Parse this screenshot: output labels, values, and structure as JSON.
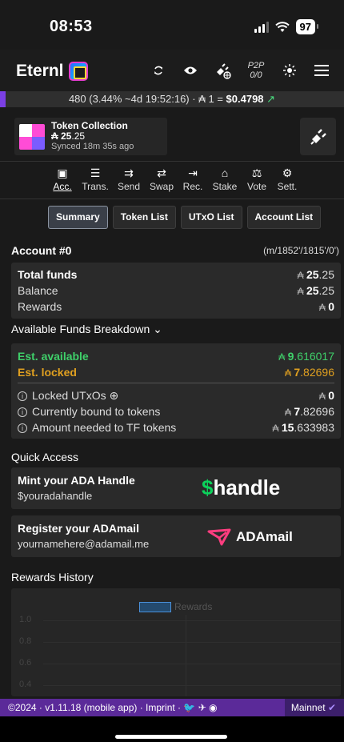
{
  "status_bar": {
    "time": "08:53",
    "battery": "97"
  },
  "header": {
    "brand": "Eternl",
    "p2p_top": "P2P",
    "p2p_bottom": "0/0",
    "icons": [
      "sync-icon",
      "eye-icon",
      "plug-globe-icon",
      "plug-p2p-icon",
      "sun-icon",
      "menu-icon"
    ]
  },
  "info_strip": {
    "epoch_text": "480 (3.44%  ~4d 19:52:16) · ₳ 1 = ",
    "price": "$0.4798",
    "trend": "↗"
  },
  "token_collection": {
    "title": "Token Collection",
    "amount_int": "₳ 25",
    "amount_dec": ".25",
    "synced": "Synced 18m 35s ago"
  },
  "nav": [
    {
      "label": "Acc.",
      "icon": "▣",
      "active": true
    },
    {
      "label": "Trans.",
      "icon": "☰"
    },
    {
      "label": "Send",
      "icon": "⇉"
    },
    {
      "label": "Swap",
      "icon": "⇄"
    },
    {
      "label": "Rec.",
      "icon": "⇥"
    },
    {
      "label": "Stake",
      "icon": "⌂"
    },
    {
      "label": "Vote",
      "icon": "⚖"
    },
    {
      "label": "Sett.",
      "icon": "⚙"
    }
  ],
  "subtabs": [
    "Summary",
    "Token List",
    "UTxO List",
    "Account List"
  ],
  "account": {
    "title": "Account #0",
    "path": "(m/1852'/1815'/0')",
    "total_label": "Total funds",
    "total_int": "25",
    "total_dec": ".25",
    "balance_label": "Balance",
    "balance_int": "25",
    "balance_dec": ".25",
    "rewards_label": "Rewards",
    "rewards_val": "0"
  },
  "breakdown": {
    "title": "Available Funds Breakdown ⌄",
    "available_label": "Est. available",
    "available_int": "9",
    "available_dec": ".616017",
    "locked_label": "Est. locked",
    "locked_int": "7",
    "locked_dec": ".82696",
    "utxo_label": "Locked UTxOs ⊕",
    "utxo_val": "0",
    "bound_label": "Currently bound to tokens",
    "bound_int": "7",
    "bound_dec": ".82696",
    "needed_label": "Amount needed to TF tokens",
    "needed_int": "15",
    "needed_dec": ".633983"
  },
  "quick_access": {
    "title": "Quick Access",
    "handle_title": "Mint your ADA Handle",
    "handle_sub": "$youradahandle",
    "handle_logo": "handle",
    "mail_title": "Register your ADAmail",
    "mail_sub": "yournamehere@adamail.me",
    "mail_logo": "ADAmail"
  },
  "rewards_history": {
    "title": "Rewards History",
    "legend": "Rewards",
    "yticks": [
      "1.0",
      "0.8",
      "0.6",
      "0.4"
    ]
  },
  "footer": {
    "text": "©2024 · v1.11.18 (mobile app) · Imprint · ",
    "network": "Mainnet"
  },
  "colors": {
    "accent": "#7b3fe4",
    "green": "#3fd06a",
    "gold": "#e0a020"
  }
}
